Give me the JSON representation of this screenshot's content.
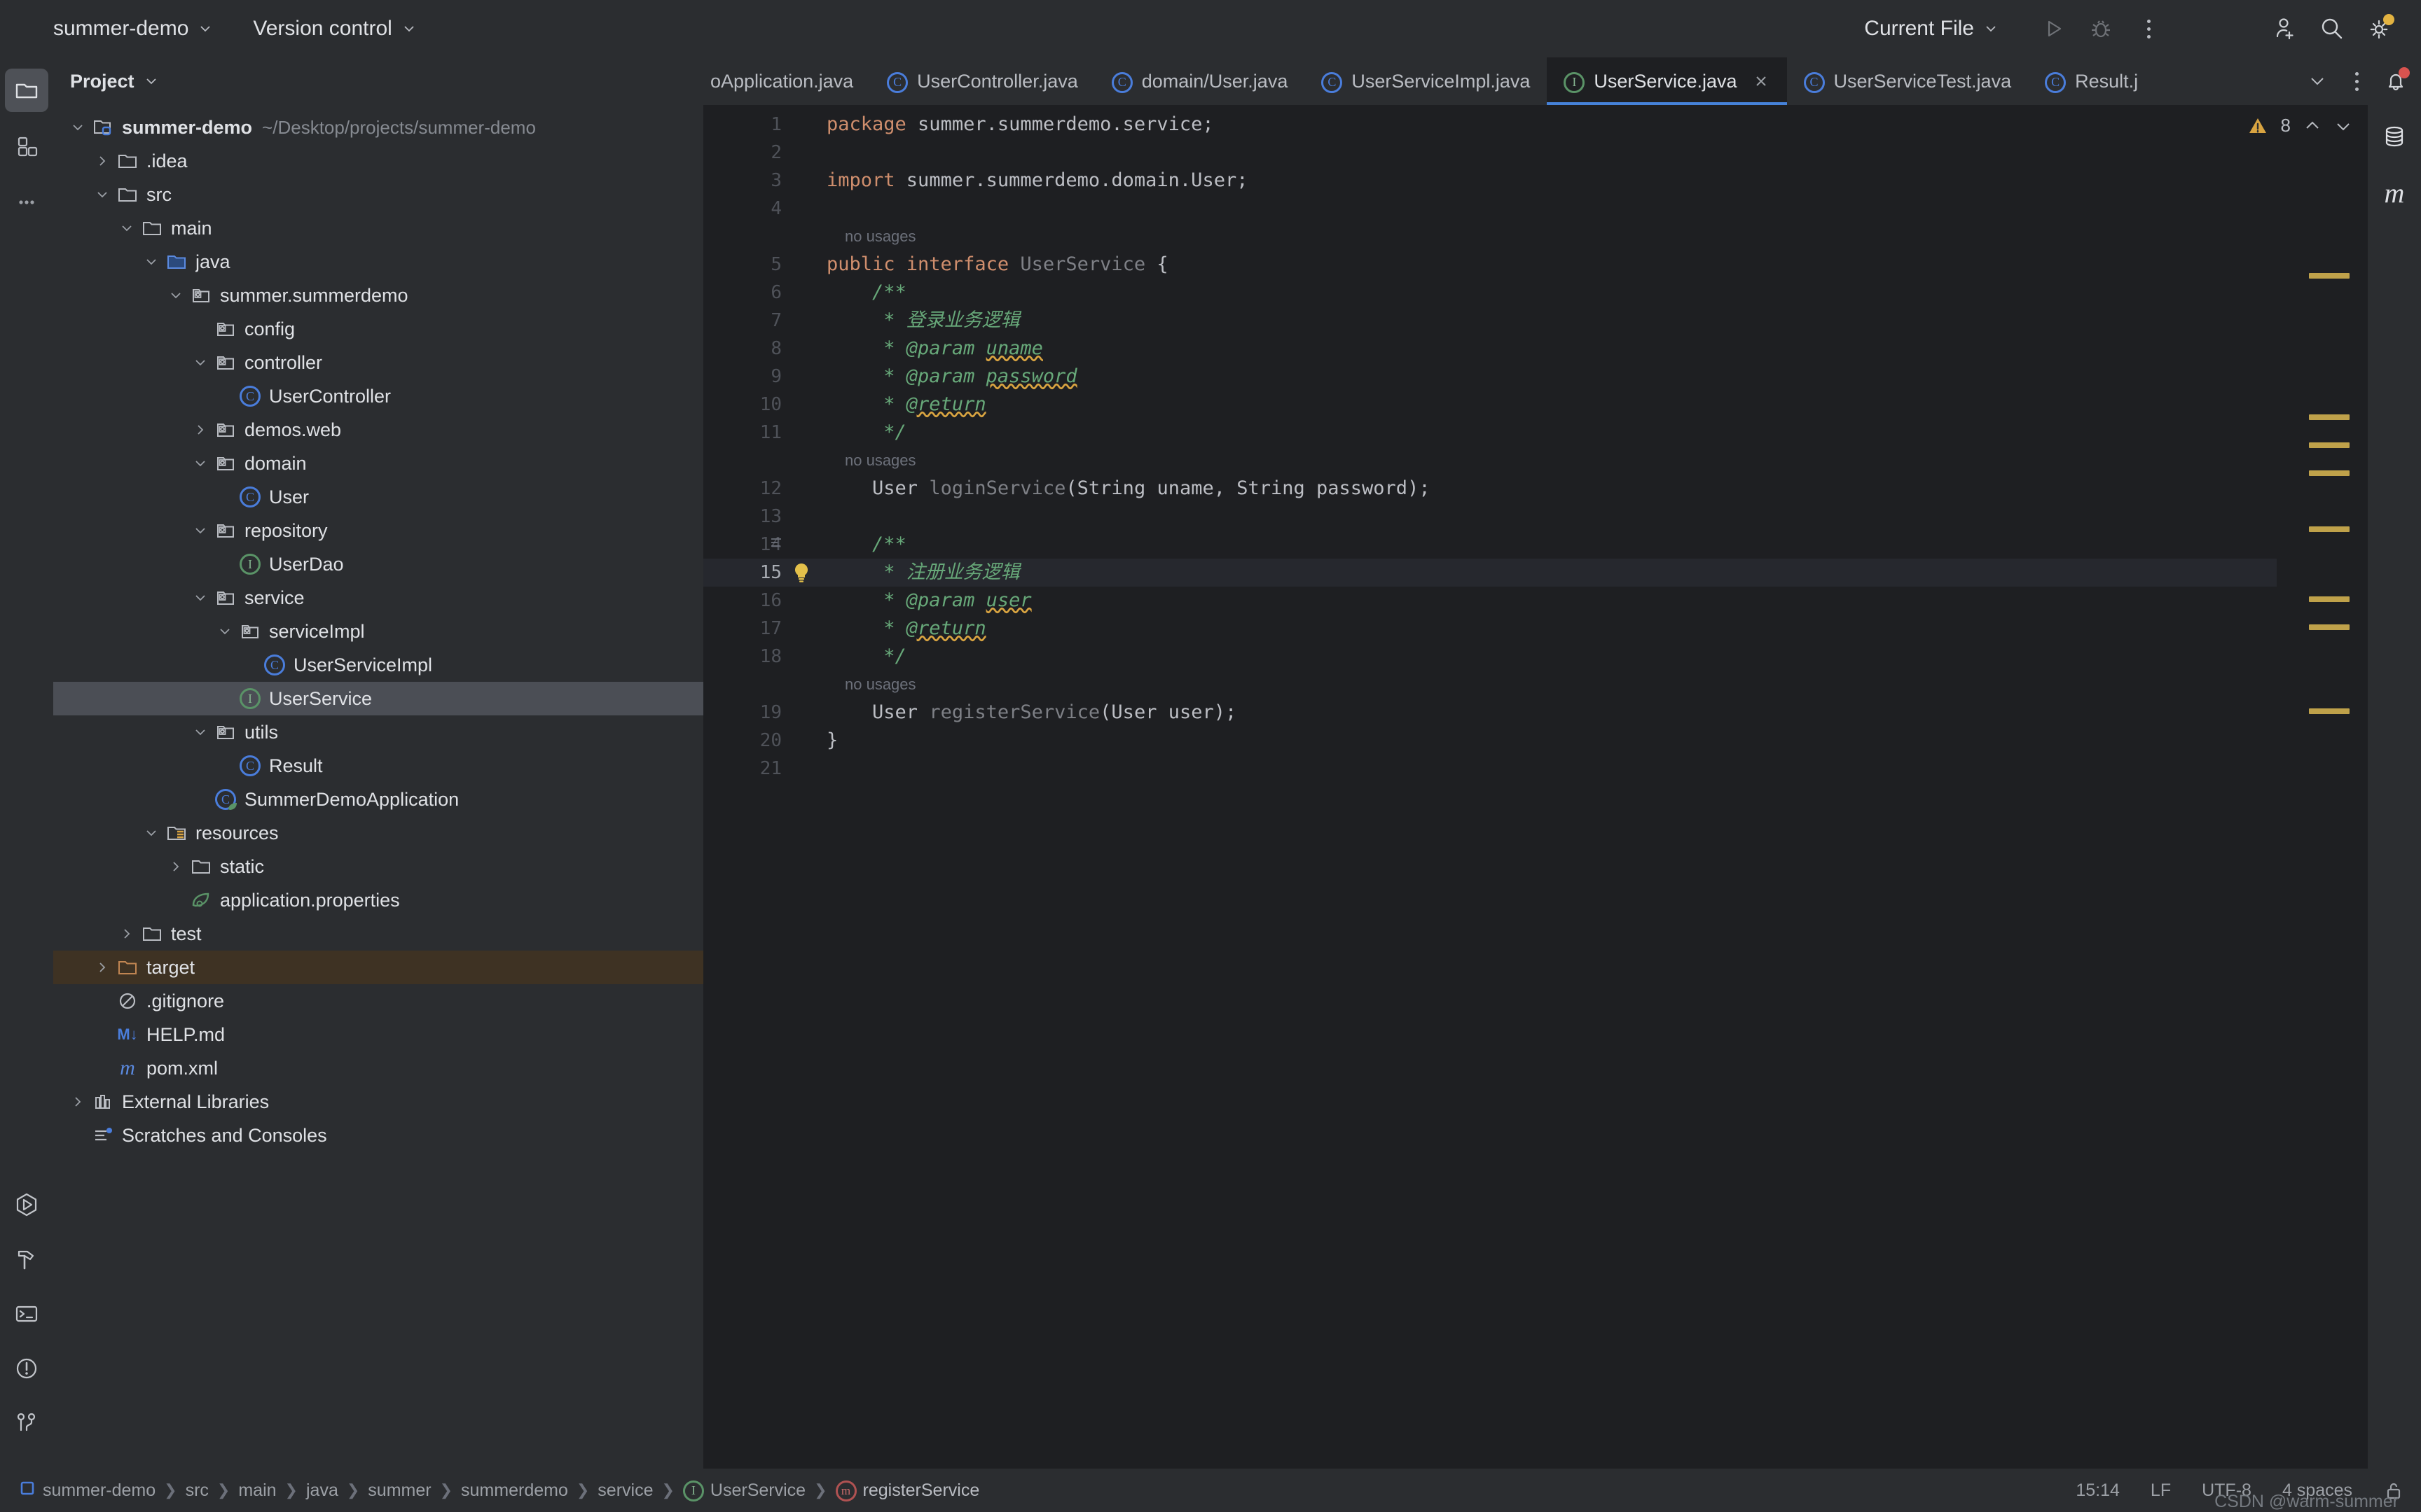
{
  "topbar": {
    "project_name": "summer-demo",
    "vcs_label": "Version control",
    "run_config": "Current File",
    "icons": {
      "run": "run-icon",
      "debug": "debug-icon",
      "more": "more-options-icon",
      "add_user": "add-user-icon",
      "search": "search-icon",
      "settings": "settings-icon"
    }
  },
  "left_stripe": {
    "top": [
      {
        "name": "project-tool-window",
        "icon": "folder-icon",
        "active": true
      },
      {
        "name": "structure-tool-window",
        "icon": "structure-grid-icon",
        "active": false
      },
      {
        "name": "more-tool-windows",
        "icon": "ellipsis-icon",
        "active": false
      }
    ],
    "bottom": [
      {
        "name": "run-tool-window",
        "icon": "run-hexagon-icon"
      },
      {
        "name": "build-tool-window",
        "icon": "hammer-icon"
      },
      {
        "name": "terminal-tool-window",
        "icon": "terminal-icon"
      },
      {
        "name": "problems-tool-window",
        "icon": "exclamation-circle-icon"
      },
      {
        "name": "git-tool-window",
        "icon": "git-branch-icon"
      }
    ]
  },
  "right_stripe": [
    {
      "name": "database-tool-window",
      "icon": "database-icon"
    },
    {
      "name": "maven-tool-window",
      "icon": "maven-m-icon"
    }
  ],
  "project_panel": {
    "title": "Project",
    "tree": [
      {
        "depth": 0,
        "arrow": "down",
        "icon": "project-folder-icon",
        "label": "summer-demo",
        "bold": true,
        "sub": "~/Desktop/projects/summer-demo"
      },
      {
        "depth": 1,
        "arrow": "right",
        "icon": "folder-icon",
        "label": ".idea"
      },
      {
        "depth": 1,
        "arrow": "down",
        "icon": "folder-icon",
        "label": "src"
      },
      {
        "depth": 2,
        "arrow": "down",
        "icon": "folder-icon",
        "label": "main"
      },
      {
        "depth": 3,
        "arrow": "down",
        "icon": "source-folder-icon",
        "label": "java"
      },
      {
        "depth": 4,
        "arrow": "down",
        "icon": "package-icon",
        "label": "summer.summerdemo"
      },
      {
        "depth": 5,
        "arrow": "none",
        "icon": "package-icon",
        "label": "config"
      },
      {
        "depth": 5,
        "arrow": "down",
        "icon": "package-icon",
        "label": "controller"
      },
      {
        "depth": 6,
        "arrow": "none",
        "icon": "class-icon",
        "label": "UserController"
      },
      {
        "depth": 5,
        "arrow": "right",
        "icon": "package-icon",
        "label": "demos.web"
      },
      {
        "depth": 5,
        "arrow": "down",
        "icon": "package-icon",
        "label": "domain"
      },
      {
        "depth": 6,
        "arrow": "none",
        "icon": "class-icon",
        "label": "User"
      },
      {
        "depth": 5,
        "arrow": "down",
        "icon": "package-icon",
        "label": "repository"
      },
      {
        "depth": 6,
        "arrow": "none",
        "icon": "interface-icon",
        "label": "UserDao"
      },
      {
        "depth": 5,
        "arrow": "down",
        "icon": "package-icon",
        "label": "service"
      },
      {
        "depth": 6,
        "arrow": "down",
        "icon": "package-icon",
        "label": "serviceImpl"
      },
      {
        "depth": 7,
        "arrow": "none",
        "icon": "class-icon",
        "label": "UserServiceImpl"
      },
      {
        "depth": 6,
        "arrow": "none",
        "icon": "interface-icon",
        "label": "UserService",
        "selected": true
      },
      {
        "depth": 5,
        "arrow": "down",
        "icon": "package-icon",
        "label": "utils"
      },
      {
        "depth": 6,
        "arrow": "none",
        "icon": "class-icon",
        "label": "Result"
      },
      {
        "depth": 5,
        "arrow": "none",
        "icon": "spring-class-icon",
        "label": "SummerDemoApplication"
      },
      {
        "depth": 3,
        "arrow": "down",
        "icon": "resources-folder-icon",
        "label": "resources"
      },
      {
        "depth": 4,
        "arrow": "right",
        "icon": "folder-icon",
        "label": "static"
      },
      {
        "depth": 4,
        "arrow": "none",
        "icon": "spring-properties-icon",
        "label": "application.properties"
      },
      {
        "depth": 2,
        "arrow": "right",
        "icon": "folder-icon",
        "label": "test"
      },
      {
        "depth": 1,
        "arrow": "right",
        "icon": "excluded-folder-icon",
        "label": "target",
        "excluded": true
      },
      {
        "depth": 1,
        "arrow": "none",
        "icon": "gitignore-icon",
        "label": ".gitignore"
      },
      {
        "depth": 1,
        "arrow": "none",
        "icon": "markdown-icon",
        "label": "HELP.md"
      },
      {
        "depth": 1,
        "arrow": "none",
        "icon": "maven-m-icon",
        "label": "pom.xml"
      },
      {
        "depth": 0,
        "arrow": "right",
        "icon": "libraries-icon",
        "label": "External Libraries"
      },
      {
        "depth": 0,
        "arrow": "none",
        "icon": "scratches-icon",
        "label": "Scratches and Consoles"
      }
    ]
  },
  "editor": {
    "tabs": [
      {
        "label": "oApplication.java",
        "icon": "none",
        "active": false,
        "truncated_left": true
      },
      {
        "label": "UserController.java",
        "icon": "class-icon",
        "active": false
      },
      {
        "label": "domain/User.java",
        "icon": "class-icon",
        "active": false
      },
      {
        "label": "UserServiceImpl.java",
        "icon": "class-icon",
        "active": false
      },
      {
        "label": "UserService.java",
        "icon": "interface-icon",
        "active": true,
        "closable": true
      },
      {
        "label": "UserServiceTest.java",
        "icon": "class-icon",
        "active": false
      },
      {
        "label": "Result.j",
        "icon": "class-icon",
        "active": false,
        "truncated_right": true
      }
    ],
    "tab_controls": {
      "dropdown": "chevron-down-icon",
      "more": "more-options-icon",
      "notifications": "bell-icon"
    },
    "inspection": {
      "warning_count": "8",
      "prev": "chevron-up-icon",
      "next": "chevron-down-icon"
    },
    "lines": [
      {
        "n": "1",
        "segments": [
          {
            "t": "package",
            "c": "k"
          },
          {
            "t": " summer.summerdemo.service;",
            "c": "plain"
          }
        ]
      },
      {
        "n": "2",
        "segments": []
      },
      {
        "n": "3",
        "segments": [
          {
            "t": "import",
            "c": "k"
          },
          {
            "t": " summer.summerdemo.domain.User;",
            "c": "plain"
          }
        ]
      },
      {
        "n": "4",
        "segments": []
      },
      {
        "n": "",
        "hint": "no usages"
      },
      {
        "n": "5",
        "segments": [
          {
            "t": "public interface",
            "c": "k"
          },
          {
            "t": " ",
            "c": "plain"
          },
          {
            "t": "UserService",
            "c": "idn"
          },
          {
            "t": " {",
            "c": "plain"
          }
        ]
      },
      {
        "n": "6",
        "segments": [
          {
            "t": "    /**",
            "c": "cmt"
          }
        ]
      },
      {
        "n": "7",
        "segments": [
          {
            "t": "     * 登录业务逻辑",
            "c": "cmt"
          }
        ]
      },
      {
        "n": "8",
        "segments": [
          {
            "t": "     * ",
            "c": "cmt"
          },
          {
            "t": "@param",
            "c": "cmt"
          },
          {
            "t": " ",
            "c": "cmt"
          },
          {
            "t": "uname",
            "c": "cmu"
          }
        ]
      },
      {
        "n": "9",
        "segments": [
          {
            "t": "     * ",
            "c": "cmt"
          },
          {
            "t": "@param",
            "c": "cmt"
          },
          {
            "t": " ",
            "c": "cmt"
          },
          {
            "t": "password",
            "c": "cmu"
          }
        ]
      },
      {
        "n": "10",
        "segments": [
          {
            "t": "     * ",
            "c": "cmt"
          },
          {
            "t": "@return",
            "c": "cmu"
          }
        ]
      },
      {
        "n": "11",
        "segments": [
          {
            "t": "     */",
            "c": "cmt"
          }
        ]
      },
      {
        "n": "",
        "hint": "no usages"
      },
      {
        "n": "12",
        "segments": [
          {
            "t": "    ",
            "c": "plain"
          },
          {
            "t": "User",
            "c": "typ"
          },
          {
            "t": " ",
            "c": "plain"
          },
          {
            "t": "loginService",
            "c": "idn"
          },
          {
            "t": "(String uname, String password);",
            "c": "plain"
          }
        ]
      },
      {
        "n": "13",
        "segments": []
      },
      {
        "n": "14",
        "segments": [
          {
            "t": "    /**",
            "c": "cmt"
          }
        ],
        "fold": true
      },
      {
        "n": "15",
        "segments": [
          {
            "t": "     * 注册业务逻辑",
            "c": "cmt"
          }
        ],
        "caret": true,
        "bulb": true
      },
      {
        "n": "16",
        "segments": [
          {
            "t": "     * ",
            "c": "cmt"
          },
          {
            "t": "@param",
            "c": "cmt"
          },
          {
            "t": " ",
            "c": "cmt"
          },
          {
            "t": "user",
            "c": "cmu"
          }
        ]
      },
      {
        "n": "17",
        "segments": [
          {
            "t": "     * ",
            "c": "cmt"
          },
          {
            "t": "@return",
            "c": "cmu"
          }
        ]
      },
      {
        "n": "18",
        "segments": [
          {
            "t": "     */",
            "c": "cmt"
          }
        ]
      },
      {
        "n": "",
        "hint": "no usages"
      },
      {
        "n": "19",
        "segments": [
          {
            "t": "    ",
            "c": "plain"
          },
          {
            "t": "User",
            "c": "typ"
          },
          {
            "t": " ",
            "c": "plain"
          },
          {
            "t": "registerService",
            "c": "idn"
          },
          {
            "t": "(User user);",
            "c": "plain"
          }
        ]
      },
      {
        "n": "20",
        "segments": [
          {
            "t": "}",
            "c": "plain"
          }
        ]
      },
      {
        "n": "21",
        "segments": []
      }
    ],
    "stripe_markers": [
      240,
      442,
      482,
      522,
      602,
      702,
      742,
      862
    ]
  },
  "status_bar": {
    "breadcrumbs": [
      {
        "label": "summer-demo",
        "icon": "module-icon"
      },
      {
        "label": "src"
      },
      {
        "label": "main"
      },
      {
        "label": "java"
      },
      {
        "label": "summer"
      },
      {
        "label": "summerdemo"
      },
      {
        "label": "service"
      },
      {
        "label": "UserService",
        "icon": "interface-icon"
      },
      {
        "label": "registerService",
        "icon": "method-icon"
      }
    ],
    "time": "15:14",
    "line_sep": "LF",
    "encoding": "UTF-8",
    "indent": "4 spaces",
    "lock_icon": "unlock-icon",
    "watermark": "CSDN @warm-summer"
  },
  "colors": {
    "bg_chrome": "#2b2d30",
    "bg_editor": "#1e1f22",
    "accent_blue": "#4682d9",
    "warning": "#d9a441",
    "selection": "#4b4e55",
    "excluded": "#3e3223"
  }
}
